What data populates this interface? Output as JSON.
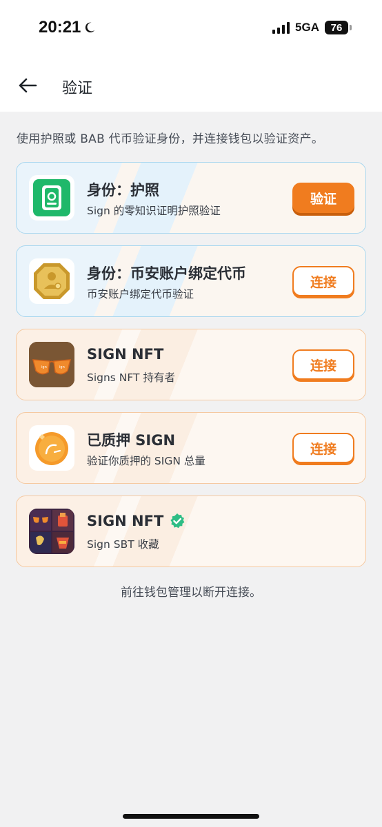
{
  "status_bar": {
    "time": "20:21",
    "network": "5GA",
    "battery": "76"
  },
  "header": {
    "title": "验证"
  },
  "description": "使用护照或 BAB 代币验证身份，并连接钱包以验证资产。",
  "cards": [
    {
      "title": "身份：护照",
      "subtitle": "Sign 的零知识证明护照验证",
      "action": "验证",
      "icon": "passport-icon",
      "theme": "blue"
    },
    {
      "title": "身份：币安账户绑定代币",
      "subtitle": "币安账户绑定代币验证",
      "action": "连接",
      "icon": "bab-token-icon",
      "theme": "blue"
    },
    {
      "title": "SIGN NFT",
      "subtitle": "Signs NFT 持有者",
      "action": "连接",
      "icon": "sign-nft-glasses-icon",
      "theme": "orange"
    },
    {
      "title": "已质押 SIGN",
      "subtitle": "验证你质押的 SIGN 总量",
      "action": "连接",
      "icon": "sign-coin-icon",
      "theme": "orange"
    },
    {
      "title": "SIGN NFT",
      "subtitle": "Sign SBT 收藏",
      "action": "",
      "icon": "sbt-collection-icon",
      "verified": true,
      "theme": "orange"
    }
  ],
  "footer_note": "前往钱包管理以断开连接。",
  "colors": {
    "accent": "#f07c1f",
    "verified": "#2ebd85",
    "blue_border": "#a9d7ef",
    "orange_border": "#f5c9a1"
  }
}
